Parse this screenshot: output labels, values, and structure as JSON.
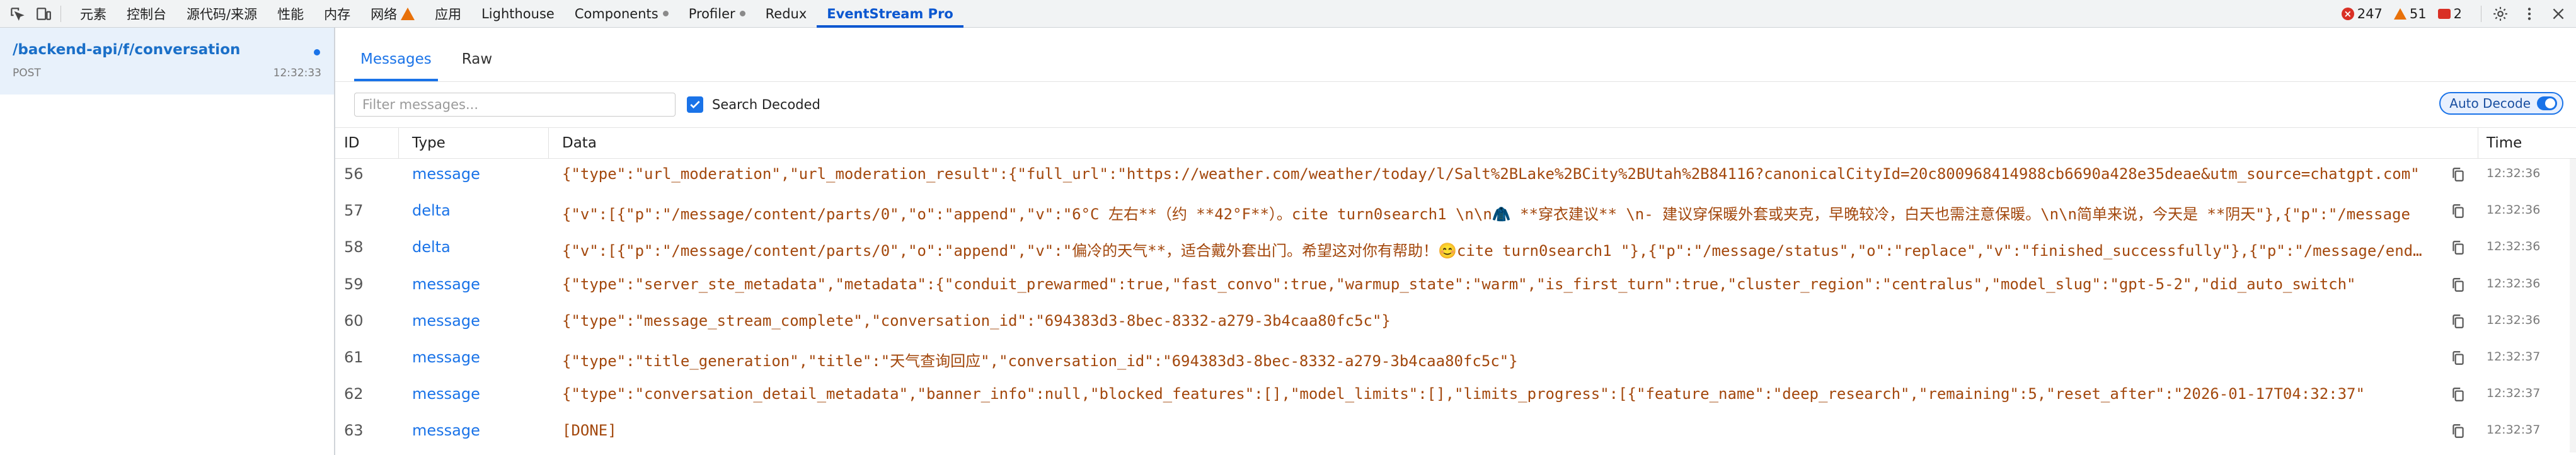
{
  "topbar": {
    "tabs": [
      {
        "label": "元素",
        "icon": null
      },
      {
        "label": "控制台",
        "icon": null
      },
      {
        "label": "源代码/来源",
        "icon": null
      },
      {
        "label": "性能",
        "icon": null
      },
      {
        "label": "内存",
        "icon": null
      },
      {
        "label": "网络",
        "icon": "warning-icon"
      },
      {
        "label": "应用",
        "icon": null
      },
      {
        "label": "Lighthouse",
        "icon": null
      },
      {
        "label": "Components",
        "icon": "dot-icon"
      },
      {
        "label": "Profiler",
        "icon": "dot-icon"
      },
      {
        "label": "Redux",
        "icon": null
      },
      {
        "label": "EventStream Pro",
        "icon": null,
        "active": true
      }
    ],
    "errors": "247",
    "warnings": "51",
    "issues": "2"
  },
  "left_panel": {
    "requests": [
      {
        "url": "/backend-api/f/conversation",
        "method": "POST",
        "time": "12:32:33"
      }
    ]
  },
  "main": {
    "tabs": [
      {
        "label": "Messages",
        "active": true
      },
      {
        "label": "Raw",
        "active": false
      }
    ],
    "filter_placeholder": "Filter messages...",
    "search_decoded_label": "Search Decoded",
    "search_decoded_checked": true,
    "auto_decode_label": "Auto Decode",
    "auto_decode_on": true,
    "columns": {
      "id": "ID",
      "type": "Type",
      "data": "Data",
      "time": "Time"
    },
    "rows": [
      {
        "id": "56",
        "type": "message",
        "data": "{\"type\":\"url_moderation\",\"url_moderation_result\":{\"full_url\":\"https://weather.com/weather/today/l/Salt%2BLake%2BCity%2BUtah%2B84116?canonicalCityId=20c800968414988cb6690a428e35deae&utm_source=chatgpt.com\"",
        "time": "12:32:36"
      },
      {
        "id": "57",
        "type": "delta",
        "data": "{\"v\":[{\"p\":\"/message/content/parts/0\",\"o\":\"append\",\"v\":\"6°C 左右**（约 **42°F**）。cite turn0search1 \\n\\n🧥 **穿衣建议** \\n- 建议穿保暖外套或夹克，早晚较冷，白天也需注意保暖。\\n\\n简单来说，今天是 **阴天\"},{\"p\":\"/message",
        "time": "12:32:36"
      },
      {
        "id": "58",
        "type": "delta",
        "data": "{\"v\":[{\"p\":\"/message/content/parts/0\",\"o\":\"append\",\"v\":\"偏冷的天气**，适合戴外套出门。希望这对你有帮助！😊cite turn0search1 \"},{\"p\":\"/message/status\",\"o\":\"replace\",\"v\":\"finished_successfully\"},{\"p\":\"/message/end_turn\"",
        "time": "12:32:36"
      },
      {
        "id": "59",
        "type": "message",
        "data": "{\"type\":\"server_ste_metadata\",\"metadata\":{\"conduit_prewarmed\":true,\"fast_convo\":true,\"warmup_state\":\"warm\",\"is_first_turn\":true,\"cluster_region\":\"centralus\",\"model_slug\":\"gpt-5-2\",\"did_auto_switch\"",
        "time": "12:32:36"
      },
      {
        "id": "60",
        "type": "message",
        "data": "{\"type\":\"message_stream_complete\",\"conversation_id\":\"694383d3-8bec-8332-a279-3b4caa80fc5c\"}",
        "time": "12:32:36"
      },
      {
        "id": "61",
        "type": "message",
        "data": "{\"type\":\"title_generation\",\"title\":\"天气查询回应\",\"conversation_id\":\"694383d3-8bec-8332-a279-3b4caa80fc5c\"}",
        "time": "12:32:37"
      },
      {
        "id": "62",
        "type": "message",
        "data": "{\"type\":\"conversation_detail_metadata\",\"banner_info\":null,\"blocked_features\":[],\"model_limits\":[],\"limits_progress\":[{\"feature_name\":\"deep_research\",\"remaining\":5,\"reset_after\":\"2026-01-17T04:32:37\"",
        "time": "12:32:37"
      },
      {
        "id": "63",
        "type": "message",
        "data": "[DONE]",
        "time": "12:32:37"
      }
    ]
  },
  "colors": {
    "accent": "#1a73e8",
    "active_tab": "#0b57d0",
    "data_text": "#a3480d",
    "error": "#d93025",
    "warning": "#e8710a",
    "selected_row": "#e8f1fb"
  }
}
